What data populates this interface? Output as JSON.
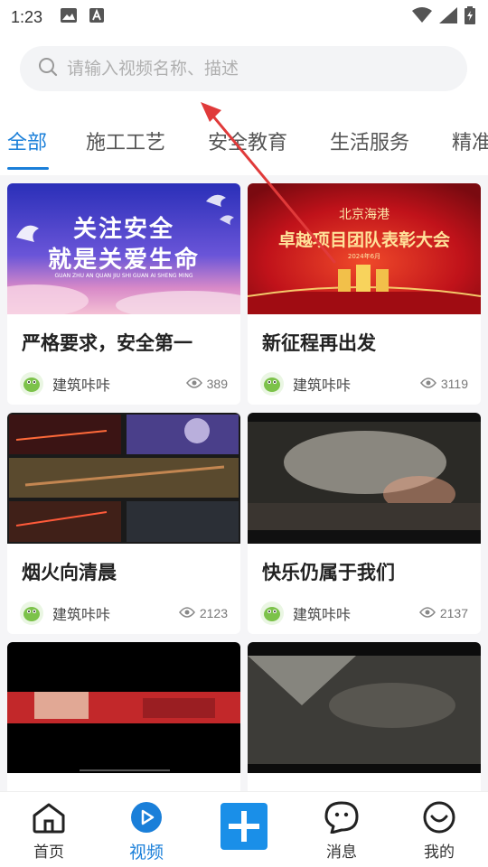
{
  "status_bar": {
    "time": "1:23"
  },
  "search": {
    "placeholder": "请输入视频名称、描述"
  },
  "tabs": [
    {
      "label": "全部",
      "active": true
    },
    {
      "label": "施工工艺"
    },
    {
      "label": "安全教育"
    },
    {
      "label": "生活服务"
    },
    {
      "label": "精准"
    }
  ],
  "videos": [
    {
      "title": "严格要求，安全第一",
      "author": "建筑咔咔",
      "views": "389",
      "thumb_text": {
        "line1": "关注安全",
        "line2": "就是关爱生命",
        "sub": "GUAN ZHU AN QUAN JIU SHI GUAN AI SHENG MING"
      }
    },
    {
      "title": "新征程再出发",
      "author": "建筑咔咔",
      "views": "3119",
      "thumb_text": {
        "top": "北京海港",
        "main": "卓越项目团队表彰大会",
        "date": "2024年6月"
      }
    },
    {
      "title": "烟火向清晨",
      "author": "建筑咔咔",
      "views": "2123"
    },
    {
      "title": "快乐仍属于我们",
      "author": "建筑咔咔",
      "views": "2137"
    },
    {
      "title": "",
      "author": "",
      "views": ""
    },
    {
      "title": "",
      "author": "",
      "views": ""
    }
  ],
  "nav": {
    "home": "首页",
    "video": "视频",
    "messages": "消息",
    "mine": "我的"
  },
  "colors": {
    "accent": "#1a7fd9",
    "annotation": "#e03a3a"
  }
}
